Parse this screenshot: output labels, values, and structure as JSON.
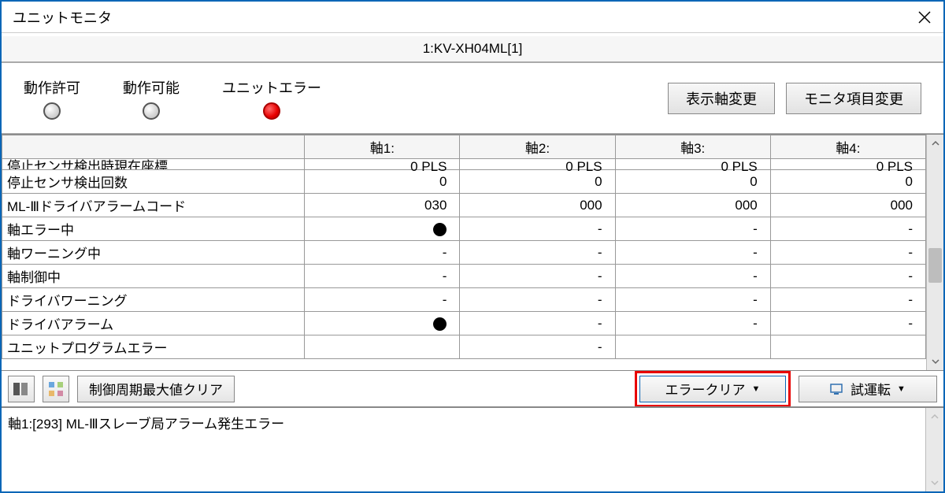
{
  "window": {
    "title": "ユニットモニタ"
  },
  "subheader": "1:KV-XH04ML[1]",
  "status": {
    "items": [
      {
        "label": "動作許可",
        "active": false
      },
      {
        "label": "動作可能",
        "active": false
      },
      {
        "label": "ユニットエラー",
        "active": true
      }
    ]
  },
  "top_buttons": {
    "display_axis_change": "表示軸変更",
    "monitor_item_change": "モニタ項目変更"
  },
  "table": {
    "columns": [
      "",
      "軸1:",
      "軸2:",
      "軸3:",
      "軸4:"
    ],
    "rows": [
      {
        "label": "停止センサ検出時現在座標",
        "cells": [
          "0 PLS",
          "0 PLS",
          "0 PLS",
          "0 PLS"
        ],
        "clipped": true
      },
      {
        "label": "停止センサ検出回数",
        "cells": [
          "0",
          "0",
          "0",
          "0"
        ]
      },
      {
        "label": "ML-Ⅲドライバアラームコード",
        "cells": [
          "030",
          "000",
          "000",
          "000"
        ]
      },
      {
        "label": "軸エラー中",
        "cells": [
          "●",
          "-",
          "-",
          "-"
        ]
      },
      {
        "label": "軸ワーニング中",
        "cells": [
          "-",
          "-",
          "-",
          "-"
        ]
      },
      {
        "label": "軸制御中",
        "cells": [
          "-",
          "-",
          "-",
          "-"
        ]
      },
      {
        "label": "ドライバワーニング",
        "cells": [
          "-",
          "-",
          "-",
          "-"
        ]
      },
      {
        "label": "ドライバアラーム",
        "cells": [
          "●",
          "-",
          "-",
          "-"
        ]
      },
      {
        "label": "ユニットプログラムエラー",
        "cells": [
          "",
          "-",
          "",
          ""
        ]
      }
    ]
  },
  "bottom": {
    "control_cycle_clear": "制御周期最大値クリア",
    "error_clear": "エラークリア",
    "test_run": "試運転"
  },
  "status_msg": "軸1:[293] ML-Ⅲスレーブ局アラーム発生エラー",
  "colors": {
    "highlight": "#e80000",
    "accent_blue": "#0a66b7"
  }
}
